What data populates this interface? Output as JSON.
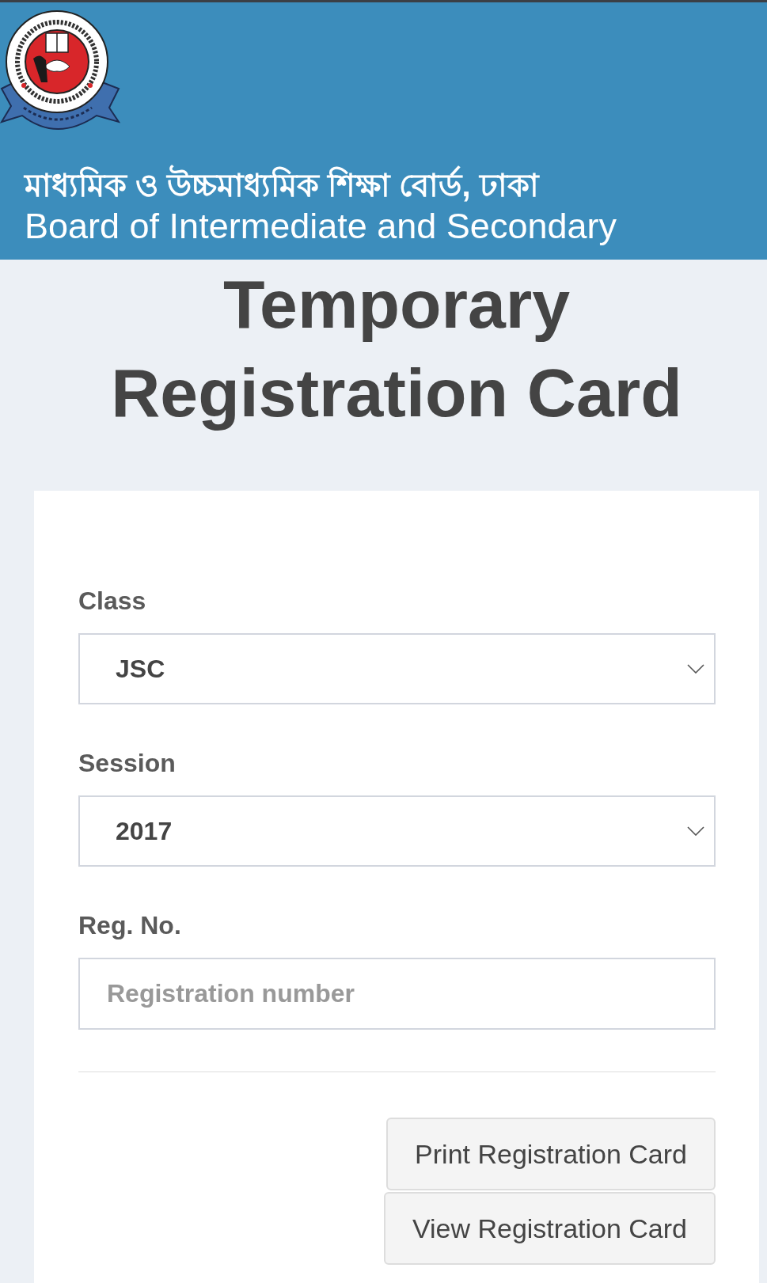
{
  "header": {
    "title_bn": "মাধ্যমিক ও উচ্চমাধ্যমিক শিক্ষা বোর্ড, ঢাকা",
    "title_en": "Board of Intermediate and Secondary"
  },
  "page_title": "Temporary Registration Card",
  "form": {
    "fields": [
      {
        "kind": "select",
        "label": "Class",
        "value": "JSC"
      },
      {
        "kind": "select",
        "label": "Session",
        "value": "2017"
      },
      {
        "kind": "input",
        "label": "Reg. No.",
        "placeholder": "Registration number"
      }
    ],
    "buttons": [
      "Print Registration Card",
      "View Registration Card"
    ]
  }
}
